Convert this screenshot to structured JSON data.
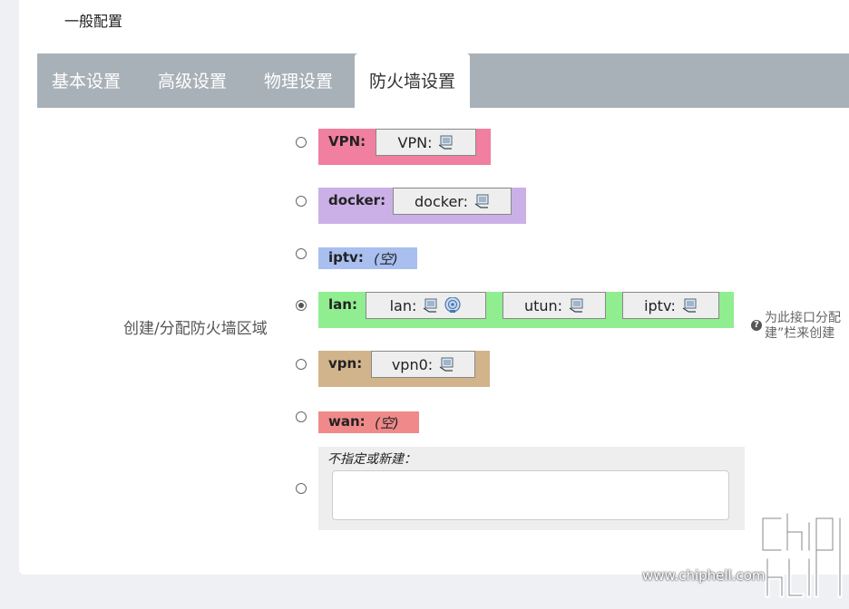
{
  "section": {
    "title": "一般配置"
  },
  "tabs": [
    {
      "label": "基本设置"
    },
    {
      "label": "高级设置"
    },
    {
      "label": "物理设置"
    },
    {
      "label": "防火墙设置"
    }
  ],
  "field": {
    "label": "创建/分配防火墙区域"
  },
  "zones": [
    {
      "name": "VPN:",
      "color": "#f07fa0",
      "devices": [
        "VPN:"
      ]
    },
    {
      "name": "docker:",
      "color": "#cbb0e8",
      "devices": [
        "docker:"
      ]
    },
    {
      "name": "iptv:",
      "color": "#a8bff0",
      "empty": "(空)"
    },
    {
      "name": "lan:",
      "color": "#90ee90",
      "devices": [
        "lan:",
        "utun:",
        "iptv:"
      ],
      "checked": true
    },
    {
      "name": "vpn:",
      "color": "#d2b48c",
      "devices": [
        "vpn0:"
      ]
    },
    {
      "name": "wan:",
      "color": "#f08a8a",
      "empty": "(空)"
    }
  ],
  "new_zone": {
    "label": "不指定或新建：",
    "value": ""
  },
  "help": {
    "line1": "为此接口分配",
    "line2": "建”栏来创建"
  },
  "watermark": {
    "text": "www.chiphell.com"
  }
}
